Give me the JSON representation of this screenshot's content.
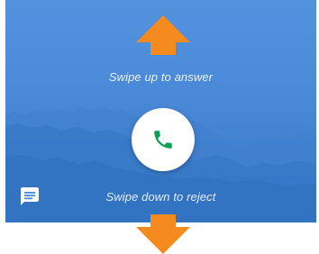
{
  "incoming_call": {
    "swipe_up_text": "Swipe up to answer",
    "swipe_down_text": "Swipe down to reject",
    "answer_icon": "phone-icon",
    "message_icon": "message-icon",
    "colors": {
      "background_top": "#5292dd",
      "background_bottom": "#3777c7",
      "mountains": "#2f6fbd",
      "arrow": "#f58a1f",
      "phone_icon": "#0f9d58",
      "answer_button": "#ffffff"
    }
  }
}
